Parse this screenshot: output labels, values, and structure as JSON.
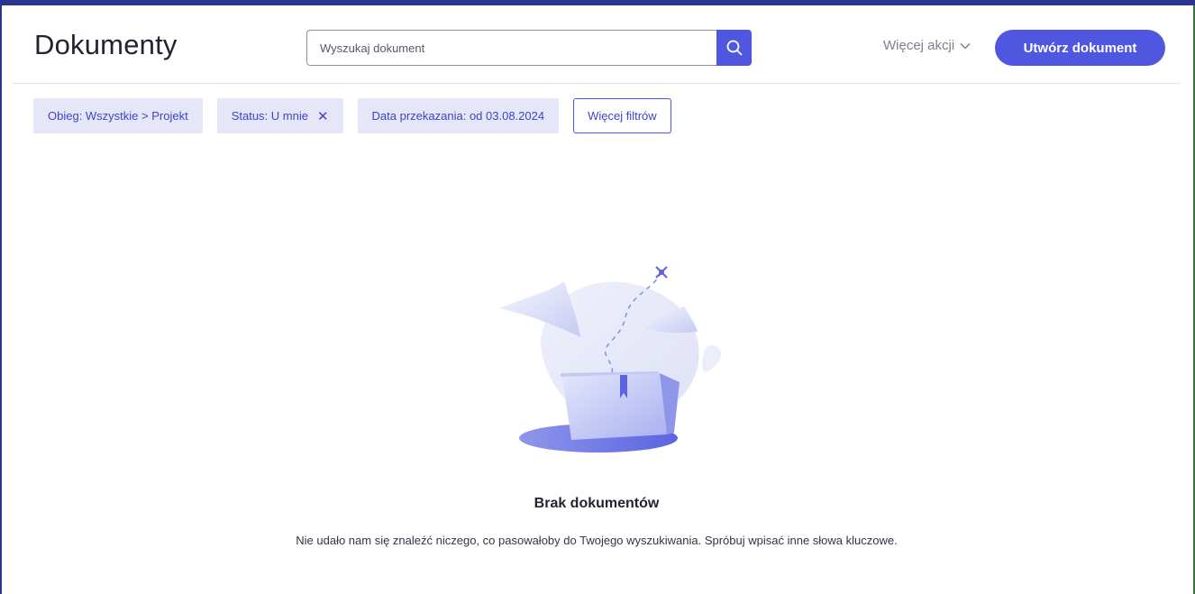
{
  "header": {
    "title": "Dokumenty",
    "search": {
      "placeholder": "Wyszukaj dokument",
      "value": ""
    },
    "more_actions_label": "Więcej akcji",
    "create_button_label": "Utwórz dokument"
  },
  "filters": {
    "chips": [
      {
        "label": "Obieg: Wszystkie > Projekt",
        "removable": false
      },
      {
        "label": "Status: U mnie",
        "removable": true
      },
      {
        "label": "Data przekazania: od 03.08.2024",
        "removable": false
      }
    ],
    "more_filters_label": "Więcej filtrów"
  },
  "empty_state": {
    "title": "Brak dokumentów",
    "message": "Nie udało nam się znaleźć niczego, co pasowałoby do Twojego wyszukiwania. Spróbuj wpisać inne słowa kluczowe."
  },
  "icons": {
    "search": "search-icon",
    "chevron": "chevron-down-icon",
    "chip_close": "close-icon",
    "illustration": "empty-folder-illustration"
  },
  "colors": {
    "accent": "#4f56e0",
    "chip_background": "#e5e6f8",
    "top_strip": "#2b3590"
  }
}
